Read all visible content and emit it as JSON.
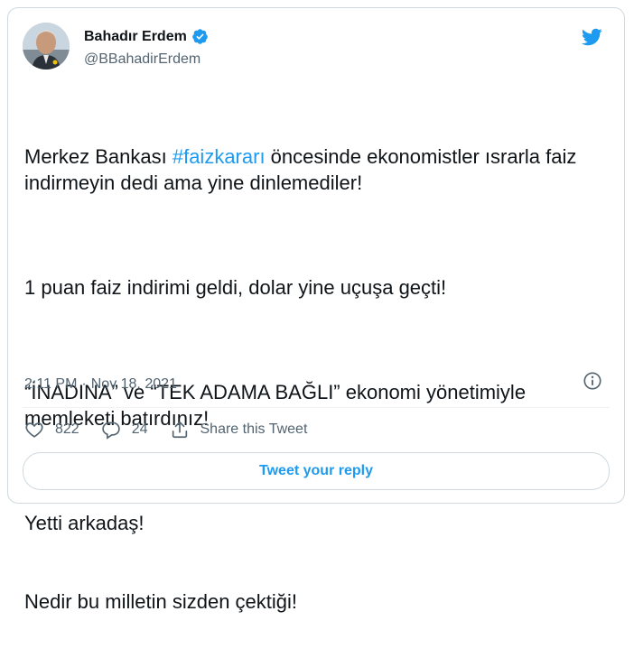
{
  "author": {
    "name": "Bahadır Erdem",
    "handle": "@BBahadirErdem",
    "verified": true
  },
  "tweet": {
    "line1_before": "Merkez Bankası ",
    "hashtag": "#faizkararı",
    "line1_after": " öncesinde ekonomistler ısrarla faiz indirmeyin dedi ama yine dinlemediler!",
    "para2": "1 puan faiz indirimi geldi, dolar yine uçuşa geçti!",
    "para3": "“İNADINA” ve “TEK ADAMA BAĞLI” ekonomi yönetimiyle memleketi batırdınız!",
    "para4_line1": "Yetti arkadaş!",
    "para4_line2": "Nedir bu milletin sizden çektiği!"
  },
  "meta": {
    "time": "2:11 PM",
    "separator": "·",
    "date": "Nov 18, 2021"
  },
  "actions": {
    "likes": "822",
    "replies": "24",
    "share_label": "Share this Tweet"
  },
  "reply_button": "Tweet your reply",
  "colors": {
    "accent": "#1d9bf0",
    "text": "#0f1419",
    "muted": "#536471",
    "border": "#cfd9de"
  },
  "icons": [
    "twitter-bird-icon",
    "verified-badge-icon",
    "info-icon",
    "heart-icon",
    "reply-icon",
    "share-icon"
  ]
}
